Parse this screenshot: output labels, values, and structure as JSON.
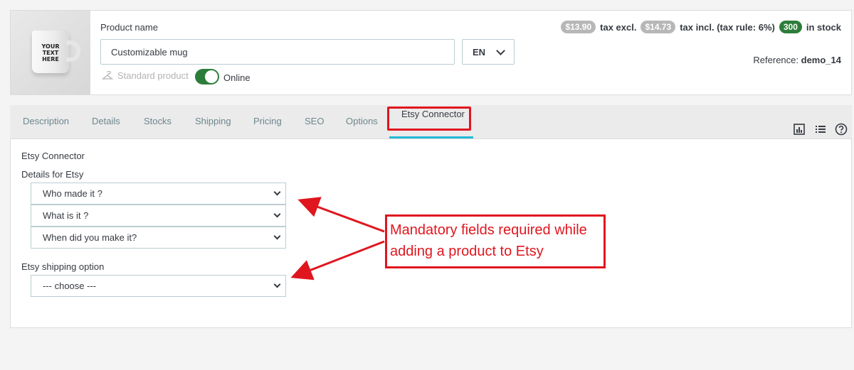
{
  "header": {
    "image_text": "YOUR TEXT HERE",
    "product_name_label": "Product name",
    "product_name_value": "Customizable mug",
    "language": "EN",
    "product_type": "Standard product",
    "status_label": "Online",
    "status_on": true,
    "price_excl": "$13.90",
    "price_excl_label": "tax excl.",
    "price_incl": "$14.73",
    "price_incl_label": "tax incl. (tax rule: 6%)",
    "stock_count": "300",
    "stock_label": "in stock",
    "reference_label": "Reference:",
    "reference_value": "demo_14"
  },
  "tabs": [
    {
      "label": "Description"
    },
    {
      "label": "Details"
    },
    {
      "label": "Stocks"
    },
    {
      "label": "Shipping"
    },
    {
      "label": "Pricing"
    },
    {
      "label": "SEO"
    },
    {
      "label": "Options"
    },
    {
      "label": "Etsy Connector"
    }
  ],
  "active_tab": "Etsy Connector",
  "toolbar_icons": [
    "bar-chart-icon",
    "list-icon",
    "help-icon"
  ],
  "etsy": {
    "section_title": "Etsy Connector",
    "details_label": "Details for Etsy",
    "selects": [
      "Who made it ?",
      "What is it ?",
      "When did you make it?"
    ],
    "shipping_label": "Etsy shipping option",
    "shipping_select": "--- choose ---"
  },
  "annotation": {
    "line1": "Mandatory fields required while",
    "line2": "adding a product to Etsy"
  },
  "colors": {
    "accent": "#25b9d7",
    "status_green": "#2d7d3a",
    "annotation_red": "#e0161f"
  }
}
